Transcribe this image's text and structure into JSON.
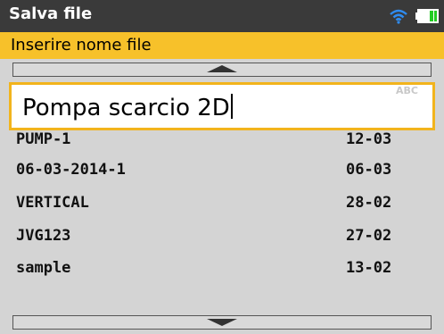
{
  "header": {
    "title": "Salva file",
    "wifi_icon": "wifi-icon",
    "battery_icon": "battery-icon",
    "wifi_color": "#2f8cf0",
    "battery_fill_color": "#22cc22"
  },
  "subheader": {
    "label": "Inserire nome file",
    "color": "#f7c12a"
  },
  "input": {
    "value": "Pompa scarcio 2D",
    "mode": "ABC"
  },
  "files": [
    {
      "name": "PUMP-1",
      "date": "12-03"
    },
    {
      "name": "06-03-2014-1",
      "date": "06-03"
    },
    {
      "name": "VERTICAL",
      "date": "28-02"
    },
    {
      "name": "JVG123",
      "date": "27-02"
    },
    {
      "name": "sample",
      "date": "13-02"
    }
  ],
  "scroll": {
    "up_icon": "arrow-up-icon",
    "down_icon": "arrow-down-icon"
  }
}
